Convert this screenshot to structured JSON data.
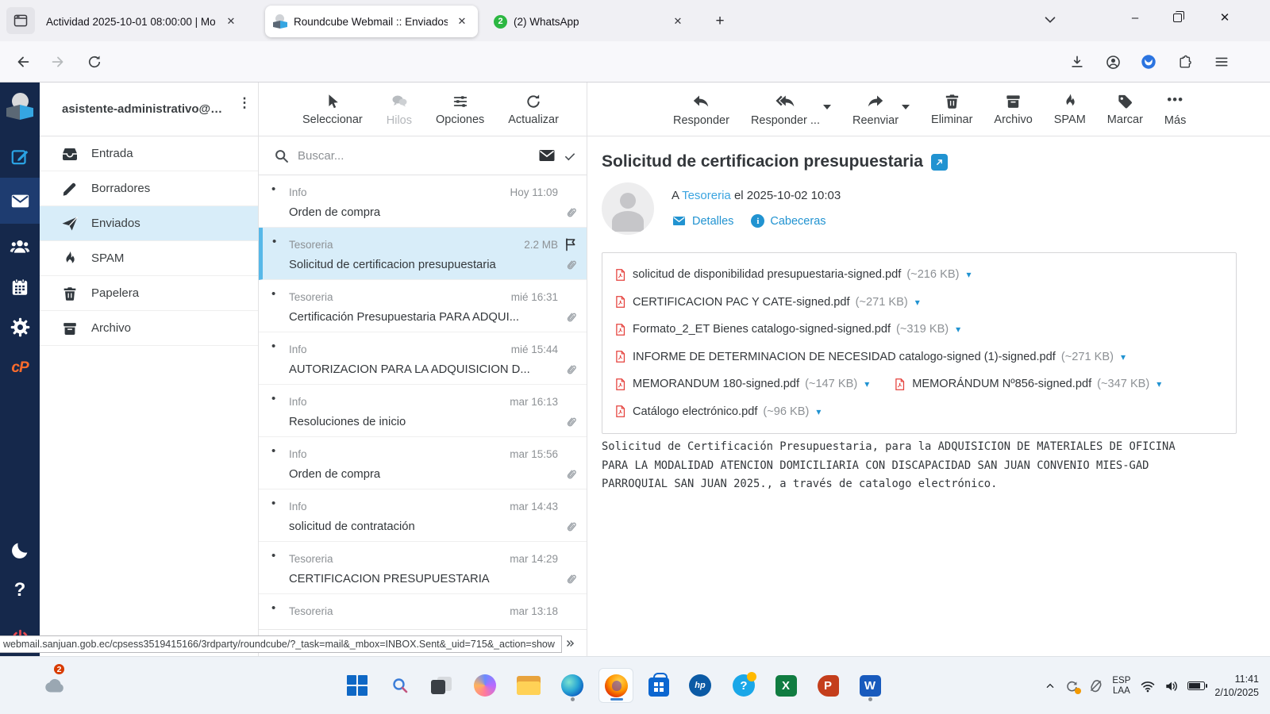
{
  "browser": {
    "tabs": [
      {
        "title": "Actividad 2025-10-01 08:00:00 | Mo",
        "active": false
      },
      {
        "title": "Roundcube Webmail :: Enviados",
        "active": true
      },
      {
        "title": "(2) WhatsApp",
        "active": false,
        "badge": "2"
      }
    ],
    "url_sub": "webmail.",
    "url_domain": "sanjuan.gob.ec",
    "url_path": "/cpsess3519415166/3rdparty/roundcube/?_task=mail&_mbox=INBOX.Sent",
    "status_url": "webmail.sanjuan.gob.ec/cpsess3519415166/3rdparty/roundcube/?_task=mail&_mbox=INBOX.Sent&_uid=715&_action=show"
  },
  "icons": {
    "close": "✕",
    "new_tab": "+",
    "minimize": "–",
    "kebab": "⋮",
    "more": "•••",
    "bullet": "•",
    "caret_down": "▾",
    "star": "☆"
  },
  "webmail": {
    "account": "asistente-administrativo@…",
    "folders": [
      {
        "label": "Entrada",
        "selected": false
      },
      {
        "label": "Borradores",
        "selected": false
      },
      {
        "label": "Enviados",
        "selected": true
      },
      {
        "label": "SPAM",
        "selected": false
      },
      {
        "label": "Papelera",
        "selected": false
      },
      {
        "label": "Archivo",
        "selected": false
      }
    ],
    "list_toolbar": [
      {
        "label": "Seleccionar",
        "disabled": false
      },
      {
        "label": "Hilos",
        "disabled": true
      },
      {
        "label": "Opciones",
        "disabled": false
      },
      {
        "label": "Actualizar",
        "disabled": false
      }
    ],
    "search_placeholder": "Buscar...",
    "messages": [
      {
        "sender": "Info",
        "meta": "Hoy 11:09",
        "subject": "Orden de compra",
        "flagged": false,
        "selected": false
      },
      {
        "sender": "Tesoreria",
        "meta": "2.2 MB",
        "subject": "Solicitud de certificacion presupuestaria",
        "flagged": true,
        "selected": true
      },
      {
        "sender": "Tesoreria",
        "meta": "mié 16:31",
        "subject": "Certificación Presupuestaria PARA ADQUI...",
        "flagged": false,
        "selected": false
      },
      {
        "sender": "Info",
        "meta": "mié 15:44",
        "subject": "AUTORIZACION PARA LA ADQUISICION D...",
        "flagged": false,
        "selected": false
      },
      {
        "sender": "Info",
        "meta": "mar 16:13",
        "subject": "Resoluciones de inicio",
        "flagged": false,
        "selected": false
      },
      {
        "sender": "Info",
        "meta": "mar 15:56",
        "subject": "Orden de compra",
        "flagged": false,
        "selected": false
      },
      {
        "sender": "Info",
        "meta": "mar 14:43",
        "subject": "solicitud de contratación",
        "flagged": false,
        "selected": false
      },
      {
        "sender": "Tesoreria",
        "meta": "mar 14:29",
        "subject": "CERTIFICACION PRESUPUESTARIA",
        "flagged": false,
        "selected": false
      },
      {
        "sender": "Tesoreria",
        "meta": "mar 13:18",
        "subject": "",
        "flagged": false,
        "selected": false
      }
    ],
    "view_toolbar": [
      {
        "label": "Responder"
      },
      {
        "label": "Responder ..."
      },
      {
        "label": "Reenviar"
      },
      {
        "label": "Eliminar"
      },
      {
        "label": "Archivo"
      },
      {
        "label": "SPAM"
      },
      {
        "label": "Marcar"
      },
      {
        "label": "Más"
      }
    ],
    "message": {
      "subject": "Solicitud de certificacion presupuestaria",
      "to_prefix": "A ",
      "to_name": "Tesoreria",
      "date_text": " el 2025-10-02 10:03",
      "details_label": "Detalles",
      "headers_label": "Cabeceras",
      "attachment_rows": [
        [
          {
            "name": "solicitud de disponibilidad presupuestaria-signed.pdf",
            "size": "(~216 KB)"
          }
        ],
        [
          {
            "name": "CERTIFICACION PAC Y CATE-signed.pdf",
            "size": "(~271 KB)"
          }
        ],
        [
          {
            "name": "Formato_2_ET Bienes catalogo-signed-signed.pdf",
            "size": "(~319 KB)"
          }
        ],
        [
          {
            "name": "INFORME DE DETERMINACION DE NECESIDAD catalogo-signed (1)-signed.pdf",
            "size": "(~271 KB)"
          }
        ],
        [
          {
            "name": "MEMORANDUM 180-signed.pdf",
            "size": "(~147 KB)"
          },
          {
            "name": "MEMORÁNDUM Nº856-signed.pdf",
            "size": "(~347 KB)"
          }
        ],
        [
          {
            "name": "Catálogo electrónico.pdf",
            "size": "(~96 KB)"
          }
        ]
      ],
      "body_lines": [
        "Solicitud de Certificación Presupuestaria, para la ADQUISICION DE MATERIALES DE OFICINA",
        "PARA LA MODALIDAD ATENCION DOMICILIARIA CON DISCAPACIDAD SAN JUAN CONVENIO MIES-GAD",
        "PARROQUIAL SAN JUAN 2025., a través de catalogo electrónico."
      ]
    }
  },
  "taskbar": {
    "onedrive_badge": "2",
    "language_line1": "ESP",
    "language_line2": "LAA",
    "time": "11:41",
    "date": "2/10/2025",
    "hp_label": "hp",
    "help_glyph": "?",
    "excel_glyph": "X",
    "powerpoint_glyph": "P",
    "word_glyph": "W"
  }
}
